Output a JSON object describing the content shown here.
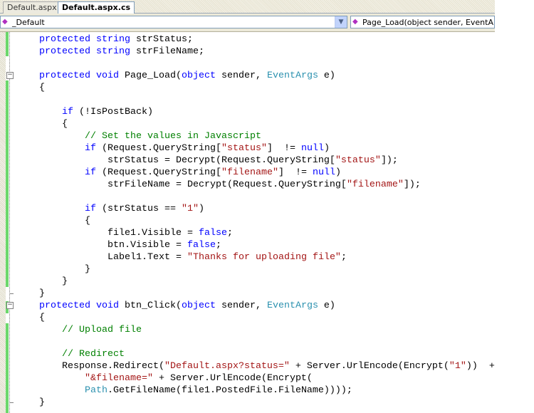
{
  "tabs": [
    {
      "label": "Default.aspx",
      "active": false
    },
    {
      "label": "Default.aspx.cs",
      "active": true
    }
  ],
  "nav": {
    "class_combo": "_Default",
    "member_combo": "Page_Load(object sender, EventArgs"
  },
  "colors": {
    "keyword": "#0000ff",
    "type": "#2b91af",
    "string": "#a31515",
    "comment": "#008000"
  },
  "code": [
    {
      "indent": 1,
      "seg": [
        [
          "k",
          "protected string"
        ],
        [
          "",
          "strStatus;"
        ]
      ]
    },
    {
      "indent": 1,
      "seg": [
        [
          "k",
          "protected string"
        ],
        [
          "",
          "strFileName;"
        ]
      ]
    },
    {
      "indent": 0,
      "seg": []
    },
    {
      "indent": 1,
      "seg": [
        [
          "k",
          "protected void"
        ],
        [
          "",
          " Page_Load("
        ],
        [
          "k",
          "object"
        ],
        [
          "",
          " sender, "
        ],
        [
          "t",
          "EventArgs"
        ],
        [
          "",
          " e)"
        ]
      ]
    },
    {
      "indent": 1,
      "seg": [
        [
          "",
          "{"
        ]
      ]
    },
    {
      "indent": 0,
      "seg": []
    },
    {
      "indent": 2,
      "seg": [
        [
          "k",
          "if"
        ],
        [
          "",
          " (!IsPostBack)"
        ]
      ]
    },
    {
      "indent": 2,
      "seg": [
        [
          "",
          "{"
        ]
      ]
    },
    {
      "indent": 3,
      "seg": [
        [
          "c",
          "// Set the values in Javascript"
        ]
      ]
    },
    {
      "indent": 3,
      "seg": [
        [
          "k",
          "if"
        ],
        [
          "",
          " (Request.QueryString["
        ],
        [
          "s",
          "\"status\""
        ],
        [
          "",
          "]  != "
        ],
        [
          "k",
          "null"
        ],
        [
          "",
          ")"
        ]
      ]
    },
    {
      "indent": 4,
      "seg": [
        [
          "",
          "strStatus = Decrypt(Request.QueryString["
        ],
        [
          "s",
          "\"status\""
        ],
        [
          "",
          "]);"
        ]
      ]
    },
    {
      "indent": 3,
      "seg": [
        [
          "k",
          "if"
        ],
        [
          "",
          " (Request.QueryString["
        ],
        [
          "s",
          "\"filename\""
        ],
        [
          "",
          "]  != "
        ],
        [
          "k",
          "null"
        ],
        [
          "",
          ")"
        ]
      ]
    },
    {
      "indent": 4,
      "seg": [
        [
          "",
          "strFileName = Decrypt(Request.QueryString["
        ],
        [
          "s",
          "\"filename\""
        ],
        [
          "",
          "]);"
        ]
      ]
    },
    {
      "indent": 0,
      "seg": []
    },
    {
      "indent": 3,
      "seg": [
        [
          "k",
          "if"
        ],
        [
          "",
          " (strStatus == "
        ],
        [
          "s",
          "\"1\""
        ],
        [
          "",
          ")"
        ]
      ]
    },
    {
      "indent": 3,
      "seg": [
        [
          "",
          "{"
        ]
      ]
    },
    {
      "indent": 4,
      "seg": [
        [
          "",
          "file1.Visible = "
        ],
        [
          "k",
          "false"
        ],
        [
          "",
          ";"
        ]
      ]
    },
    {
      "indent": 4,
      "seg": [
        [
          "",
          "btn.Visible = "
        ],
        [
          "k",
          "false"
        ],
        [
          "",
          ";"
        ]
      ]
    },
    {
      "indent": 4,
      "seg": [
        [
          "",
          "Label1.Text = "
        ],
        [
          "s",
          "\"Thanks for uploading file\""
        ],
        [
          "",
          ";"
        ]
      ]
    },
    {
      "indent": 3,
      "seg": [
        [
          "",
          "}"
        ]
      ]
    },
    {
      "indent": 2,
      "seg": [
        [
          "",
          "}"
        ]
      ]
    },
    {
      "indent": 1,
      "seg": [
        [
          "",
          "}"
        ]
      ]
    },
    {
      "indent": 1,
      "seg": [
        [
          "k",
          "protected void"
        ],
        [
          "",
          " btn_Click("
        ],
        [
          "k",
          "object"
        ],
        [
          "",
          " sender, "
        ],
        [
          "t",
          "EventArgs"
        ],
        [
          "",
          " e)"
        ]
      ]
    },
    {
      "indent": 1,
      "seg": [
        [
          "",
          "{"
        ]
      ]
    },
    {
      "indent": 2,
      "seg": [
        [
          "c",
          "// Upload file"
        ]
      ]
    },
    {
      "indent": 0,
      "seg": []
    },
    {
      "indent": 2,
      "seg": [
        [
          "c",
          "// Redirect"
        ]
      ]
    },
    {
      "indent": 2,
      "seg": [
        [
          "",
          "Response.Redirect("
        ],
        [
          "s",
          "\"Default.aspx?status=\""
        ],
        [
          "",
          " + Server.UrlEncode(Encrypt("
        ],
        [
          "s",
          "\"1\""
        ],
        [
          "",
          "))  +"
        ]
      ]
    },
    {
      "indent": 3,
      "seg": [
        [
          "s",
          "\"&filename=\""
        ],
        [
          "",
          " + Server.UrlEncode(Encrypt("
        ]
      ]
    },
    {
      "indent": 3,
      "seg": [
        [
          "t",
          "Path"
        ],
        [
          "",
          ".GetFileName(file1.PostedFile.FileName))));"
        ]
      ]
    },
    {
      "indent": 1,
      "seg": [
        [
          "",
          "}"
        ]
      ]
    }
  ]
}
